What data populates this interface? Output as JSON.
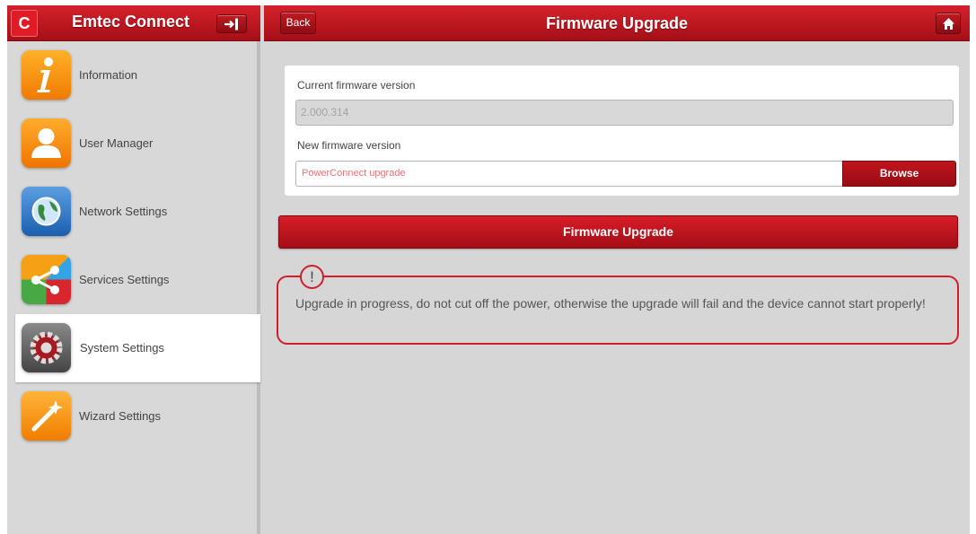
{
  "sidebar": {
    "brand_logo_letter": "C",
    "brand_title": "Emtec Connect",
    "logout_icon": "logout-icon",
    "items": [
      {
        "label": "Information",
        "icon": "information-icon",
        "active": false
      },
      {
        "label": "User Manager",
        "icon": "user-icon",
        "active": false
      },
      {
        "label": "Network Settings",
        "icon": "globe-icon",
        "active": false
      },
      {
        "label": "Services Settings",
        "icon": "share-icon",
        "active": false
      },
      {
        "label": "System Settings",
        "icon": "gear-icon",
        "active": true
      },
      {
        "label": "Wizard Settings",
        "icon": "wizard-icon",
        "active": false
      }
    ]
  },
  "header": {
    "back_label": "Back",
    "title": "Firmware Upgrade",
    "home_icon": "home-icon"
  },
  "firmware": {
    "current_label": "Current firmware version",
    "current_value": "2.000.314",
    "new_label": "New firmware version",
    "new_placeholder": "PowerConnect upgrade",
    "browse_label": "Browse",
    "upgrade_label": "Firmware Upgrade"
  },
  "warning": {
    "icon_text": "!",
    "text": "Upgrade in progress, do not cut off the power, otherwise the upgrade will fail and the device cannot start properly!"
  },
  "colors": {
    "accent": "#c0141d",
    "warning_border": "#d01f2a"
  }
}
